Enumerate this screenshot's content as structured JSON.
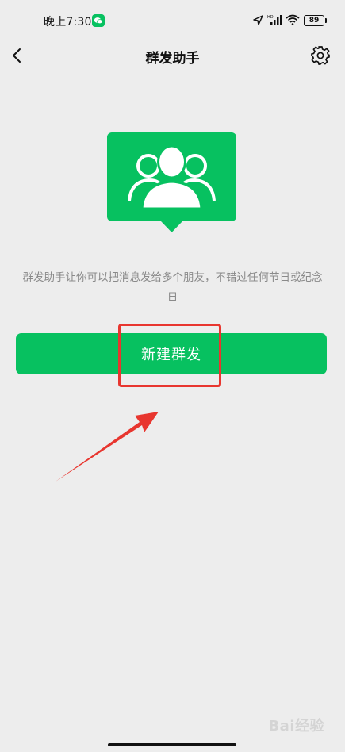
{
  "status_bar": {
    "time": "晚上7:30",
    "battery": "89"
  },
  "nav": {
    "title": "群发助手",
    "back_icon": "chevron-left-icon",
    "settings_icon": "gear-icon"
  },
  "hero_icon": "group-users-icon",
  "description": "群发助手让你可以把消息发给多个朋友，不错过任何节日或纪念日",
  "primary_button": {
    "label": "新建群发"
  },
  "watermark": "Bai经验",
  "colors": {
    "accent": "#07c160",
    "background": "#ededed",
    "annotation": "#e8362f",
    "description_text": "#8a8a8a"
  }
}
